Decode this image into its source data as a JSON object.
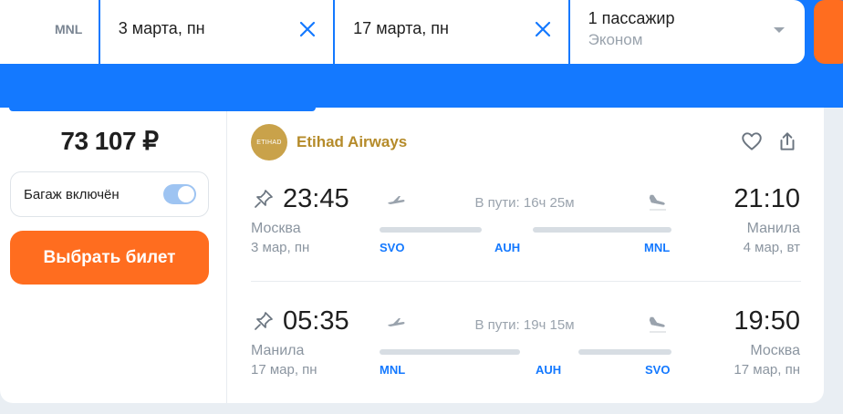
{
  "search": {
    "origin_code": "MNL",
    "depart_date": "3 марта, пн",
    "return_date": "17 марта, пн",
    "passengers": "1 пассажир",
    "cabin_class": "Эконом"
  },
  "offer": {
    "price": "73 107 ₽",
    "baggage_label": "Багаж включён",
    "baggage_included": true,
    "select_button": "Выбрать билет",
    "airline": "Etihad Airways",
    "airline_logo_text": "ETIHAD"
  },
  "segments": [
    {
      "dep_time": "23:45",
      "dep_city": "Москва",
      "dep_date": "3 мар, пн",
      "arr_time": "21:10",
      "arr_city": "Манила",
      "arr_date": "4 мар, вт",
      "duration": "В пути: 16ч 25м",
      "airports": [
        "SVO",
        "AUH",
        "MNL"
      ]
    },
    {
      "dep_time": "05:35",
      "dep_city": "Манила",
      "dep_date": "17 мар, пн",
      "arr_time": "19:50",
      "arr_city": "Москва",
      "arr_date": "17 мар, пн",
      "duration": "В пути: 19ч 15м",
      "airports": [
        "MNL",
        "AUH",
        "SVO"
      ]
    }
  ],
  "colors": {
    "accent_blue": "#1479ff",
    "cta_orange": "#ff6d1f",
    "airline_gold": "#b58b2a"
  },
  "icons": [
    "clear-icon",
    "chevron-down-icon",
    "heart-icon",
    "share-icon",
    "pin-icon",
    "takeoff-icon",
    "landing-icon"
  ]
}
